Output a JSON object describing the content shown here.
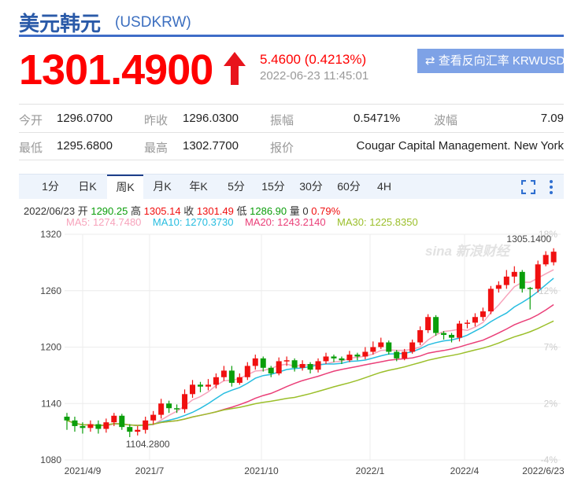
{
  "header": {
    "title": "美元韩元",
    "code": "(USDKRW)",
    "price": "1301.4900",
    "change": "5.4600 (0.4213%)",
    "time": "2022-06-23 11:45:01",
    "reverse_button": "查看反向汇率 KRWUSD"
  },
  "stats": [
    [
      {
        "label": "今开",
        "value": "1296.0700"
      },
      {
        "label": "昨收",
        "value": "1296.0300"
      },
      {
        "label": "振幅",
        "value": "0.5471%"
      },
      {
        "label": "波幅",
        "value": "7.09"
      }
    ],
    [
      {
        "label": "最低",
        "value": "1295.6800"
      },
      {
        "label": "最高",
        "value": "1302.7700"
      },
      {
        "label": "报价",
        "value": "Cougar Capital Management. New York"
      }
    ]
  ],
  "tabs": [
    "1分",
    "日K",
    "周K",
    "月K",
    "年K",
    "5分",
    "15分",
    "30分",
    "60分",
    "4H"
  ],
  "active_tab": "周K",
  "info": {
    "date": "2022/06/23",
    "open_label": "开",
    "open": "1290.25",
    "high_label": "高",
    "high": "1305.14",
    "close_label": "收",
    "close": "1301.49",
    "low_label": "低",
    "low": "1286.90",
    "vol_label": "量",
    "vol": "0",
    "pct": "0.79%"
  },
  "ma": {
    "ma5": "MA5: 1274.7480",
    "ma10": "MA10: 1270.3730",
    "ma20": "MA20: 1243.2140",
    "ma30": "MA30: 1225.8350"
  },
  "colors": {
    "up": "#f01010",
    "down": "#0b9e0b",
    "ma5": "#f7a3bb",
    "ma10": "#27bde0",
    "ma20": "#ea3f78",
    "ma30": "#9bbf2a"
  },
  "chart_data": {
    "type": "candlestick",
    "ylim": [
      1080,
      1320
    ],
    "yticks": [
      "1320",
      "1260",
      "1200",
      "1140",
      "1080"
    ],
    "pct_ticks": [
      "18%",
      "12%",
      "7%",
      "2%",
      "-4%"
    ],
    "xticks": [
      "2021/4/9",
      "2021/7",
      "2021/10",
      "2022/1",
      "2022/4",
      "2022/6/23"
    ],
    "max_label": "1305.1400",
    "min_label": "1104.2800",
    "ohlc": [
      [
        1126,
        1130,
        1112,
        1122
      ],
      [
        1122,
        1126,
        1110,
        1116
      ],
      [
        1116,
        1120,
        1108,
        1114
      ],
      [
        1114,
        1122,
        1110,
        1118
      ],
      [
        1118,
        1122,
        1108,
        1113
      ],
      [
        1113,
        1124,
        1109,
        1120
      ],
      [
        1120,
        1130,
        1116,
        1127
      ],
      [
        1127,
        1129,
        1112,
        1115
      ],
      [
        1115,
        1118,
        1104.28,
        1110
      ],
      [
        1110,
        1116,
        1106,
        1112
      ],
      [
        1112,
        1126,
        1108,
        1122
      ],
      [
        1122,
        1132,
        1118,
        1128
      ],
      [
        1128,
        1145,
        1124,
        1140
      ],
      [
        1140,
        1143,
        1130,
        1135
      ],
      [
        1135,
        1139,
        1130,
        1134
      ],
      [
        1134,
        1155,
        1130,
        1150
      ],
      [
        1150,
        1165,
        1146,
        1160
      ],
      [
        1160,
        1163,
        1152,
        1158
      ],
      [
        1158,
        1166,
        1154,
        1160
      ],
      [
        1160,
        1172,
        1156,
        1168
      ],
      [
        1168,
        1180,
        1164,
        1175
      ],
      [
        1175,
        1180,
        1158,
        1162
      ],
      [
        1162,
        1172,
        1160,
        1168
      ],
      [
        1168,
        1184,
        1165,
        1180
      ],
      [
        1180,
        1192,
        1176,
        1188
      ],
      [
        1188,
        1190,
        1174,
        1178
      ],
      [
        1178,
        1180,
        1168,
        1172
      ],
      [
        1172,
        1189,
        1170,
        1185
      ],
      [
        1185,
        1190,
        1180,
        1186
      ],
      [
        1186,
        1188,
        1174,
        1178
      ],
      [
        1178,
        1186,
        1175,
        1182
      ],
      [
        1182,
        1184,
        1172,
        1176
      ],
      [
        1176,
        1188,
        1173,
        1185
      ],
      [
        1185,
        1194,
        1182,
        1190
      ],
      [
        1190,
        1192,
        1184,
        1188
      ],
      [
        1188,
        1190,
        1182,
        1186
      ],
      [
        1186,
        1196,
        1184,
        1192
      ],
      [
        1192,
        1194,
        1186,
        1190
      ],
      [
        1190,
        1200,
        1187,
        1195
      ],
      [
        1195,
        1206,
        1192,
        1200
      ],
      [
        1200,
        1210,
        1198,
        1205
      ],
      [
        1205,
        1207,
        1192,
        1195
      ],
      [
        1195,
        1197,
        1185,
        1188
      ],
      [
        1188,
        1198,
        1186,
        1195
      ],
      [
        1195,
        1208,
        1193,
        1205
      ],
      [
        1205,
        1222,
        1202,
        1218
      ],
      [
        1218,
        1235,
        1215,
        1232
      ],
      [
        1232,
        1234,
        1212,
        1215
      ],
      [
        1215,
        1217,
        1208,
        1213
      ],
      [
        1213,
        1215,
        1205,
        1210
      ],
      [
        1210,
        1228,
        1206,
        1225
      ],
      [
        1225,
        1229,
        1220,
        1226
      ],
      [
        1226,
        1236,
        1222,
        1232
      ],
      [
        1232,
        1242,
        1228,
        1238
      ],
      [
        1238,
        1265,
        1235,
        1262
      ],
      [
        1262,
        1270,
        1258,
        1266
      ],
      [
        1266,
        1282,
        1262,
        1275
      ],
      [
        1275,
        1286,
        1268,
        1280
      ],
      [
        1280,
        1282,
        1258,
        1262
      ],
      [
        1263,
        1264,
        1240,
        1262
      ],
      [
        1262,
        1292,
        1258,
        1288
      ],
      [
        1288,
        1302,
        1286,
        1298
      ],
      [
        1290.25,
        1305.14,
        1286.9,
        1301.49
      ]
    ]
  }
}
